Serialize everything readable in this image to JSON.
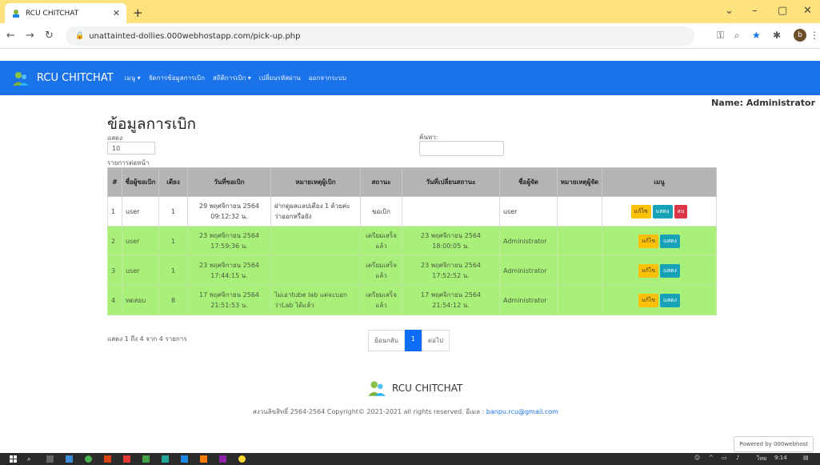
{
  "browser": {
    "tab_title": "RCU CHITCHAT",
    "url": "unattainted-dollies.000webhostapp.com/pick-up.php",
    "profile_initial": "b"
  },
  "navbar": {
    "brand": "RCU CHITCHAT",
    "items": [
      "เมนู ▾",
      "จัดการข้อมูลการเบิก",
      "สถิติการเบิก ▾",
      "เปลี่ยนรหัสผ่าน",
      "ออกจากระบบ"
    ]
  },
  "user": {
    "name_label": "Name: Administrator"
  },
  "page": {
    "title": "ข้อมูลการเบิก",
    "show_label": "แสดง",
    "page_length": "10",
    "per_page_label": "รายการต่อหน้า",
    "search_label": "ค้นหา:"
  },
  "table": {
    "headers": [
      "#",
      "ชื่อผู้ขอเบิก",
      "เตียง",
      "วันที่ขอเบิก",
      "หมายเหตุผู้เบิก",
      "สถานะ",
      "วันที่เปลี่ยนสถานะ",
      "ชื่อผู้จัด",
      "หมายเหตุผู้จัด",
      "เมนู"
    ],
    "rows": [
      {
        "no": "1",
        "requester": "user",
        "bed": "1",
        "request_date": "29 พฤศจิกายน 2564 09:12:32 น.",
        "requester_note": "ฝากดูผลแลปเตียง 1 ด้วยค่ะว่าออกหรือยัง",
        "status": "ขอเบิก",
        "status_date": "",
        "handler": "user",
        "handler_note": ""
      },
      {
        "no": "2",
        "requester": "user",
        "bed": "1",
        "request_date": "23 พฤศจิกายน 2564 17:59:36 น.",
        "requester_note": "",
        "status": "เตรียมเสร็จแล้ว",
        "status_date": "23 พฤศจิกายน 2564 18:00:05 น.",
        "handler": "Administrator",
        "handler_note": ""
      },
      {
        "no": "3",
        "requester": "user",
        "bed": "1",
        "request_date": "23 พฤศจิกายน 2564 17:44:15 น.",
        "requester_note": "",
        "status": "เตรียมเสร็จแล้ว",
        "status_date": "23 พฤศจิกายน 2564 17:52:52 น.",
        "handler": "Administrator",
        "handler_note": ""
      },
      {
        "no": "4",
        "requester": "ทดสอบ",
        "bed": "8",
        "request_date": "17 พฤศจิกายน 2564 21:51:53 น.",
        "requester_note": "ไม่เอาtube lab แต่จะบอกว่าLab ได้แล้ว",
        "status": "เตรียมเสร็จแล้ว",
        "status_date": "17 พฤศจิกายน 2564 21:54:12 น.",
        "handler": "Administrator",
        "handler_note": ""
      }
    ],
    "buttons": {
      "edit": "แก้ไข",
      "show": "แสดง",
      "delete": "ลบ"
    }
  },
  "pagination": {
    "info": "แสดง 1 ถึง 4 จาก 4 รายการ",
    "prev": "ย้อนกลับ",
    "current": "1",
    "next": "ต่อไป"
  },
  "footer": {
    "brand": "RCU CHITCHAT",
    "copyright_prefix": "สงวนลิขสิทธิ์ 2564-2564 Copyright© 2021-2021 all rights reserved. อีเมล : ",
    "email": "banpu.rcu@gmail.com",
    "powered": "Powered by 000webhost"
  },
  "taskbar": {
    "time": "9:14",
    "lang": "ไทย"
  },
  "colors": {
    "navbar": "#1a73e8",
    "row_ready": "#a9f07a",
    "tab_strip": "#fde27d"
  }
}
